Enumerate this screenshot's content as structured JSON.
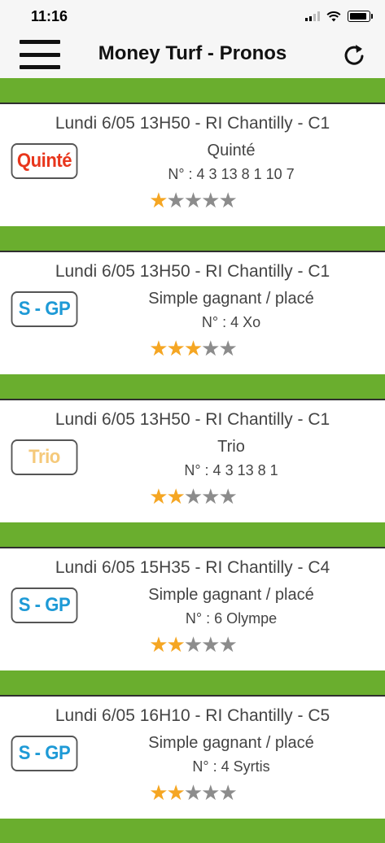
{
  "status_bar": {
    "time": "11:16"
  },
  "header": {
    "title": "Money Turf - Pronos"
  },
  "predictions": [
    {
      "title": "Lundi 6/05 13H50 - RI Chantilly - C1",
      "badge": "Quinté",
      "badge_color": "#e8361c",
      "bet_type": "Quinté",
      "numbers": "N° : 4 3 13 8 1 10 7",
      "rating": 1,
      "max_rating": 5
    },
    {
      "title": "Lundi 6/05 13H50 - RI Chantilly - C1",
      "badge": "S - GP",
      "badge_color": "#1e9ad6",
      "bet_type": "Simple gagnant / placé",
      "numbers": "N° : 4 Xo",
      "rating": 3,
      "max_rating": 5
    },
    {
      "title": "Lundi 6/05 13H50 - RI Chantilly - C1",
      "badge": "Trio",
      "badge_color": "#f5c97a",
      "bet_type": "Trio",
      "numbers": "N° : 4 3 13 8 1",
      "rating": 2,
      "max_rating": 5
    },
    {
      "title": "Lundi 6/05 15H35 - RI Chantilly - C4",
      "badge": "S - GP",
      "badge_color": "#1e9ad6",
      "bet_type": "Simple gagnant / placé",
      "numbers": "N° : 6 Olympe",
      "rating": 2,
      "max_rating": 5
    },
    {
      "title": "Lundi 6/05 16H10 - RI Chantilly - C5",
      "badge": "S - GP",
      "badge_color": "#1e9ad6",
      "bet_type": "Simple gagnant / placé",
      "numbers": "N° : 4 Syrtis",
      "rating": 2,
      "max_rating": 5
    }
  ]
}
